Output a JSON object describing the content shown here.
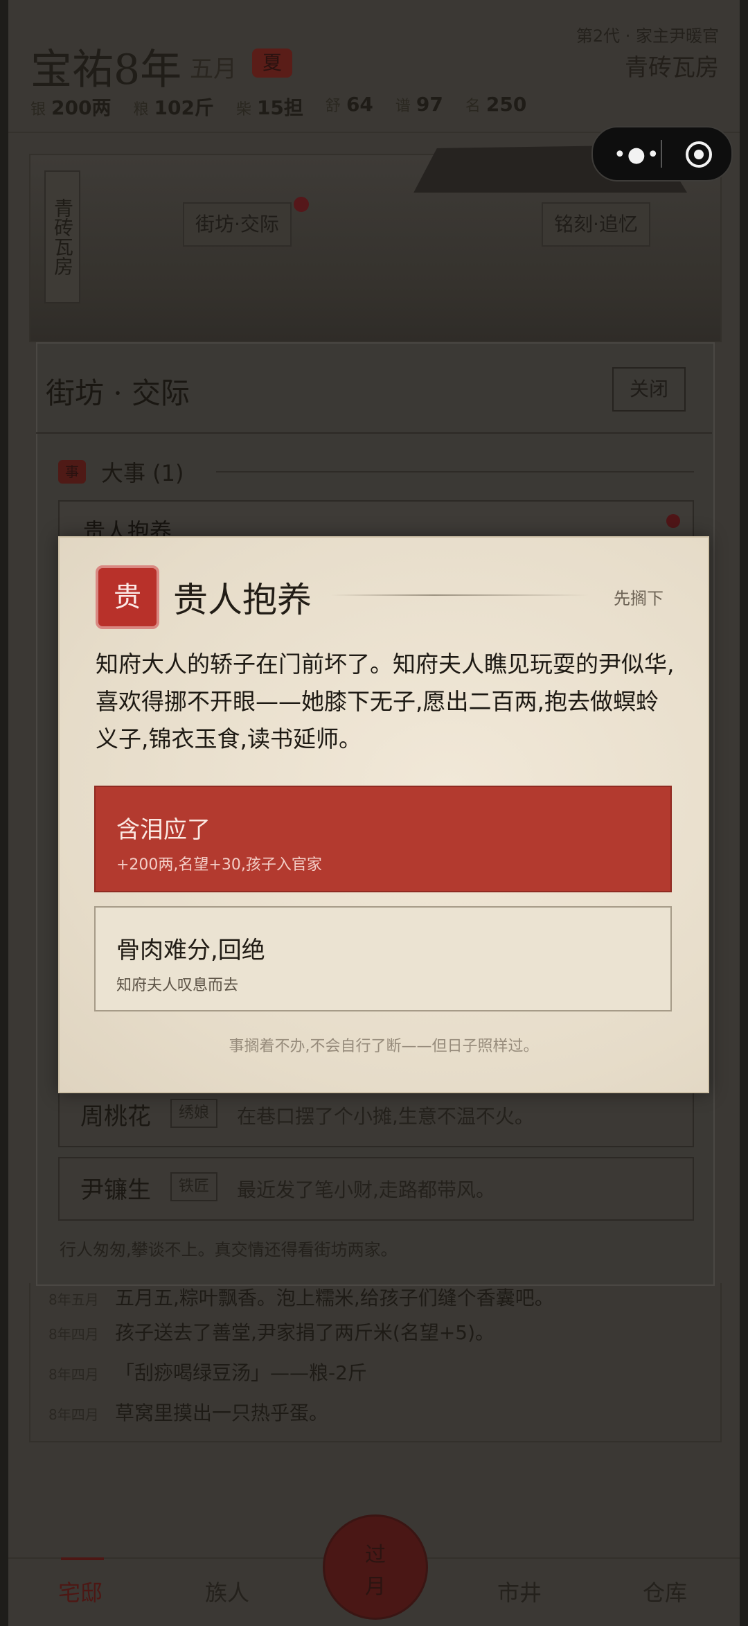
{
  "header": {
    "title": "宝祐8年",
    "month": "五月",
    "season": "夏",
    "generation": "第2代 · 家主尹暖官",
    "house": "青砖瓦房",
    "stats": [
      {
        "k": "银",
        "v": "200两"
      },
      {
        "k": "粮",
        "v": "102斤"
      },
      {
        "k": "柴",
        "v": "15担"
      },
      {
        "k": "舒",
        "v": "64"
      },
      {
        "k": "谱",
        "v": "97"
      },
      {
        "k": "名",
        "v": "250"
      }
    ]
  },
  "scene": {
    "vertical_tag": "青砖瓦房",
    "tag_social": "街坊·交际",
    "tag_memory": "铭刻·追忆"
  },
  "panel": {
    "title": "街坊 · 交际",
    "close": "关闭",
    "section_icon": "事",
    "section_title": "大事 (1)",
    "top_card": "贵人抱养",
    "people": [
      {
        "name": "周桃花",
        "role": "绣娘",
        "desc": "在巷口摆了个小摊,生意不温不火。"
      },
      {
        "name": "尹镰生",
        "role": "铁匠",
        "desc": "最近发了笔小财,走路都带风。"
      }
    ],
    "footer": "行人匆匆,攀谈不上。真交情还得看街坊两家。"
  },
  "log": [
    {
      "m": "8年五月",
      "t": "五月五,粽叶飘香。泡上糯米,给孩子们缝个香囊吧。"
    },
    {
      "m": "8年四月",
      "t": "孩子送去了善堂,尹家捐了两斤米(名望+5)。"
    },
    {
      "m": "8年四月",
      "t": "「刮痧喝绿豆汤」——粮-2斤"
    },
    {
      "m": "8年四月",
      "t": "草窝里摸出一只热乎蛋。"
    }
  ],
  "tabs": {
    "t1": "宅邸",
    "t2": "族人",
    "center_top": "过",
    "center_bottom": "月",
    "t4": "市井",
    "t5": "仓库"
  },
  "modal": {
    "icon": "贵",
    "title": "贵人抱养",
    "later": "先搁下",
    "body": "知府大人的轿子在门前坏了。知府夫人瞧见玩耍的尹似华,喜欢得挪不开眼——她膝下无子,愿出二百两,抱去做螟蛉义子,锦衣玉食,读书延师。",
    "option1_title": "含泪应了",
    "option1_sub": "+200两,名望+30,孩子入官家",
    "option2_title": "骨肉难分,回绝",
    "option2_sub": "知府夫人叹息而去",
    "note": "事搁着不办,不会自行了断——但日子照样过。"
  }
}
